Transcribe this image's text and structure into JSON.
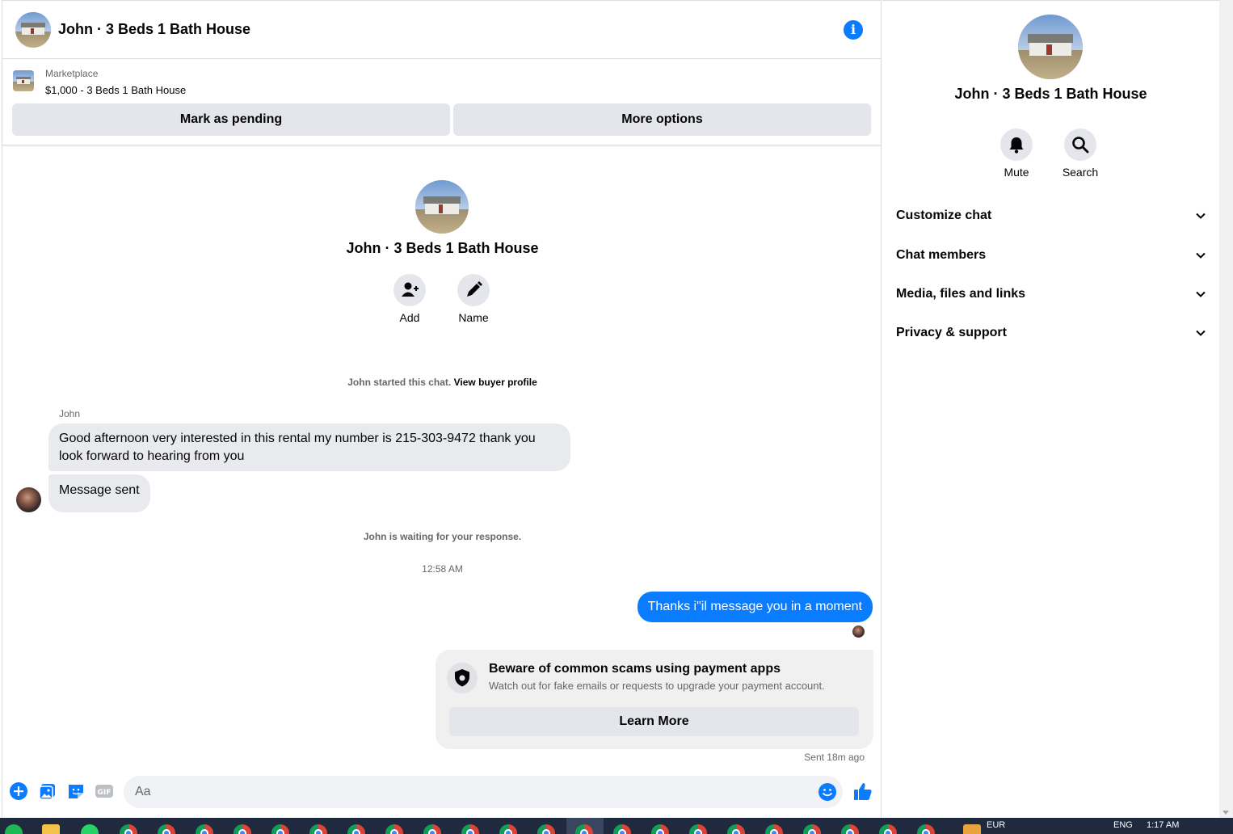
{
  "header": {
    "title": "John · 3 Beds 1 Bath House"
  },
  "listing": {
    "kicker": "Marketplace",
    "price_title": "$1,000 - 3 Beds 1 Bath House",
    "mark_pending_label": "Mark as pending",
    "more_options_label": "More options"
  },
  "intro": {
    "title": "John · 3 Beds 1 Bath House",
    "add_label": "Add",
    "name_label": "Name"
  },
  "system": {
    "started_text": "John started this chat.",
    "view_buyer_link": "View buyer profile",
    "waiting_text": "John is waiting for your response.",
    "timestamp": "12:58 AM"
  },
  "messages": {
    "sender_name": "John",
    "incoming_1": "Good afternoon very interested in this rental my number is 215-303-9472 thank you look forward to hearing from you",
    "incoming_2": "Message sent",
    "outgoing_1": "Thanks i\"il message you in a moment"
  },
  "warning": {
    "title": "Beware of common scams using payment apps",
    "text": "Watch out for fake emails or requests to upgrade your payment account.",
    "button_label": "Learn More",
    "sent_ago": "Sent 18m ago"
  },
  "composer": {
    "placeholder": "Aa"
  },
  "panel": {
    "title": "John · 3 Beds 1 Bath House",
    "mute_label": "Mute",
    "search_label": "Search",
    "sections": [
      "Customize chat",
      "Chat members",
      "Media, files and links",
      "Privacy & support"
    ]
  },
  "taskbar": {
    "lang_1": "EUR",
    "lang_2": "ENG",
    "clock": "1:17 AM"
  },
  "colors": {
    "accent": "#0a7cff",
    "bubble_in": "#e9eaed",
    "button_gray": "#e4e6eb",
    "taskbar": "#1f2a3f"
  }
}
